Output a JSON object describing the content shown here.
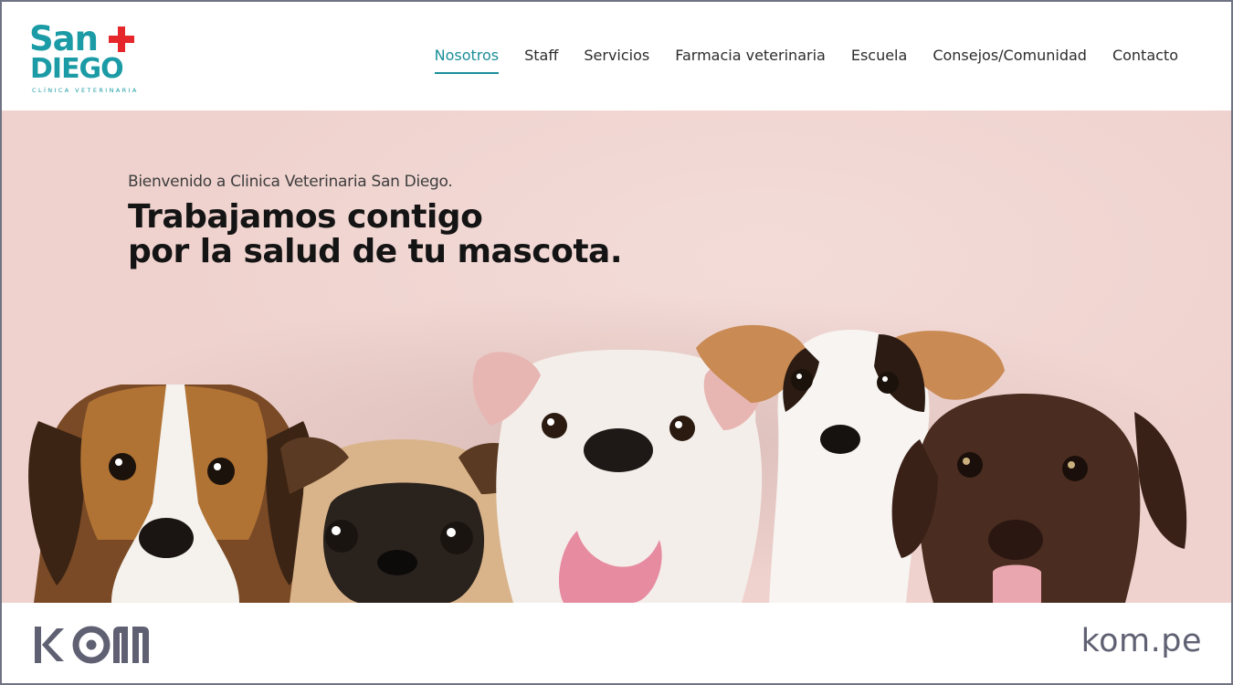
{
  "brand": {
    "name_top": "San",
    "name_bottom": "DIEGO",
    "subtitle": "CLÍNICA VETERINARIA",
    "primary_color": "#1b9ba5",
    "cross_color": "#e5262b"
  },
  "nav": {
    "items": [
      {
        "label": "Nosotros",
        "active": true
      },
      {
        "label": "Staff",
        "active": false
      },
      {
        "label": "Servicios",
        "active": false
      },
      {
        "label": "Farmacia veterinaria",
        "active": false
      },
      {
        "label": "Escuela",
        "active": false
      },
      {
        "label": "Consejos/Comunidad",
        "active": false
      },
      {
        "label": "Contacto",
        "active": false
      }
    ],
    "active_color": "#1b8e99"
  },
  "hero": {
    "intro": "Bienvenido a Clinica Veterinaria San Diego.",
    "headline_line1": "Trabajamos contigo",
    "headline_line2": "por la salud de tu mascota.",
    "background_color": "#efd2ce",
    "image_subject": "five puppies: beagle, pug, bulldog, jack russell terrier, chocolate labrador"
  },
  "footer": {
    "agency_logo": "KOM",
    "agency_url": "kom.pe",
    "logo_color": "#5f6173"
  }
}
